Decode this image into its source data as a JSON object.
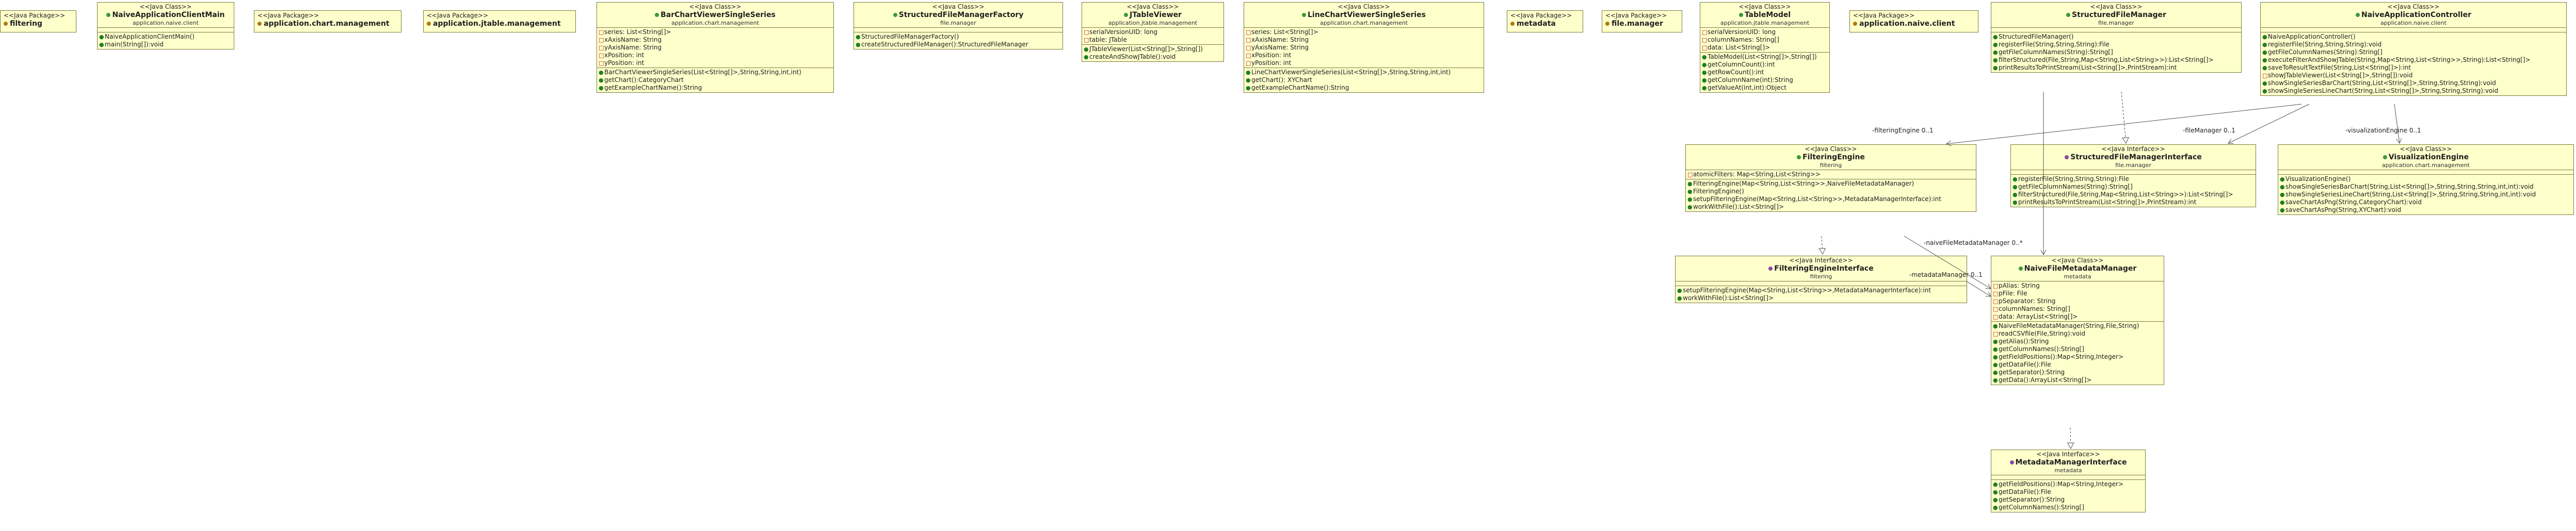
{
  "colors": {
    "box_fill": "#ffffcc",
    "box_border": "#7a7a3a",
    "class_icon": "#3a9a3a",
    "interface_icon": "#8a4aa0",
    "package_icon": "#b07a10",
    "private": "#c01010",
    "protected": "#c09010",
    "public": "#208020"
  },
  "packages": [
    {
      "id": "pkg-filtering",
      "stereotype": "<<Java Package>>",
      "name": "filtering"
    },
    {
      "id": "pkg-chart",
      "stereotype": "<<Java Package>>",
      "name": "application.chart.management"
    },
    {
      "id": "pkg-jtable",
      "stereotype": "<<Java Package>>",
      "name": "application.jtable.management"
    },
    {
      "id": "pkg-metadata",
      "stereotype": "<<Java Package>>",
      "name": "metadata"
    },
    {
      "id": "pkg-filemanager",
      "stereotype": "<<Java Package>>",
      "name": "file.manager"
    },
    {
      "id": "pkg-naive",
      "stereotype": "<<Java Package>>",
      "name": "application.naive.client"
    }
  ],
  "classes": [
    {
      "id": "c-naivemain",
      "stereotype": "<<Java Class>>",
      "name": "NaiveApplicationClientMain",
      "package": "application.naive.client",
      "kind": "class",
      "attributes": [],
      "operations": [
        {
          "vis": "public",
          "text": "NaiveApplicationClientMain()"
        },
        {
          "vis": "public",
          "text": "main(String[]):void"
        }
      ]
    },
    {
      "id": "c-barchart",
      "stereotype": "<<Java Class>>",
      "name": "BarChartViewerSingleSeries",
      "package": "application.chart.management",
      "kind": "class",
      "attributes": [
        {
          "vis": "private",
          "text": "series: List<String[]>"
        },
        {
          "vis": "private",
          "text": "xAxisName: String"
        },
        {
          "vis": "private",
          "text": "yAxisName: String"
        },
        {
          "vis": "private",
          "text": "xPosition: int"
        },
        {
          "vis": "private",
          "text": "yPosition: int"
        }
      ],
      "operations": [
        {
          "vis": "public",
          "text": "BarChartViewerSingleSeries(List<String[]>,String,String,int,int)"
        },
        {
          "vis": "public",
          "text": "getChart():CategoryChart"
        },
        {
          "vis": "public",
          "text": "getExampleChartName():String"
        }
      ]
    },
    {
      "id": "c-sfmfactory",
      "stereotype": "<<Java Class>>",
      "name": "StructuredFileManagerFactory",
      "package": "file.manager",
      "kind": "class",
      "attributes": [],
      "operations": [
        {
          "vis": "public",
          "text": "StructuredFileManagerFactory()"
        },
        {
          "vis": "public",
          "text": "createStructuredFileManager():StructuredFileManager"
        }
      ]
    },
    {
      "id": "c-jtableviewer",
      "stereotype": "<<Java Class>>",
      "name": "JTableViewer",
      "package": "application.jtable.management",
      "kind": "class",
      "attributes": [
        {
          "vis": "private",
          "text": "serialVersionUID: long"
        },
        {
          "vis": "private",
          "text": "table: JTable"
        }
      ],
      "operations": [
        {
          "vis": "public",
          "text": "JTableViewer(List<String[]>,String[])"
        },
        {
          "vis": "public",
          "text": "createAndShowJTable():void"
        }
      ]
    },
    {
      "id": "c-linechart",
      "stereotype": "<<Java Class>>",
      "name": "LineChartViewerSingleSeries",
      "package": "application.chart.management",
      "kind": "class",
      "attributes": [
        {
          "vis": "private",
          "text": "series: List<String[]>"
        },
        {
          "vis": "private",
          "text": "xAxisName: String"
        },
        {
          "vis": "private",
          "text": "yAxisName: String"
        },
        {
          "vis": "private",
          "text": "xPosition: int"
        },
        {
          "vis": "private",
          "text": "yPosition: int"
        }
      ],
      "operations": [
        {
          "vis": "public",
          "text": "LineChartViewerSingleSeries(List<String[]>,String,String,int,int)"
        },
        {
          "vis": "public",
          "text": "getChart(): XYChart"
        },
        {
          "vis": "public",
          "text": "getExampleChartName():String"
        }
      ]
    },
    {
      "id": "c-tablemodel",
      "stereotype": "<<Java Class>>",
      "name": "TableModel",
      "package": "application.jtable.management",
      "kind": "class",
      "attributes": [
        {
          "vis": "private",
          "text": "serialVersionUID: long"
        },
        {
          "vis": "private",
          "text": "columnNames: String[]"
        },
        {
          "vis": "private",
          "text": "data: List<String[]>"
        }
      ],
      "operations": [
        {
          "vis": "public",
          "text": "TableModel(List<String[]>,String[])"
        },
        {
          "vis": "public",
          "text": "getColumnCount():int"
        },
        {
          "vis": "public",
          "text": "getRowCount():int"
        },
        {
          "vis": "public",
          "text": "getColumnName(int):String"
        },
        {
          "vis": "public",
          "text": "getValueAt(int,int):Object"
        }
      ]
    },
    {
      "id": "c-sfm",
      "stereotype": "<<Java Class>>",
      "name": "StructuredFileManager",
      "package": "file.manager",
      "kind": "class",
      "attributes": [],
      "operations": [
        {
          "vis": "public",
          "text": "StructuredFileManager()"
        },
        {
          "vis": "public",
          "text": "registerFile(String,String,String):File"
        },
        {
          "vis": "public",
          "text": "getFileColumnNames(String):String[]"
        },
        {
          "vis": "public",
          "text": "filterStructured(File,String,Map<String,List<String>>):List<String[]>"
        },
        {
          "vis": "public",
          "text": "printResultsToPrintStream(List<String[]>,PrintStream):int"
        }
      ]
    },
    {
      "id": "c-nac",
      "stereotype": "<<Java Class>>",
      "name": "NaiveApplicationController",
      "package": "application.naive.client",
      "kind": "class",
      "attributes": [],
      "operations": [
        {
          "vis": "public",
          "text": "NaiveApplicationController()"
        },
        {
          "vis": "public",
          "text": "registerFile(String,String,String):void"
        },
        {
          "vis": "public",
          "text": "getFileColumnNames(String):String[]"
        },
        {
          "vis": "public",
          "text": "executeFilterAndShowJTable(String,Map<String,List<String>>,String):List<String[]>"
        },
        {
          "vis": "public",
          "text": "saveToResultTextFile(String,List<String[]>):int"
        },
        {
          "vis": "private",
          "text": "showJTableViewer(List<String[]>,String[]):void"
        },
        {
          "vis": "public",
          "text": "showSingleSeriesBarChart(String,List<String[]>,String,String,String):void"
        },
        {
          "vis": "public",
          "text": "showSingleSeriesLineChart(String,List<String[]>,String,String,String):void"
        }
      ]
    },
    {
      "id": "c-filteringengine",
      "stereotype": "<<Java Class>>",
      "name": "FilteringEngine",
      "package": "filtering",
      "kind": "class",
      "attributes": [
        {
          "vis": "private",
          "text": "atomicFilters: Map<String,List<String>>"
        }
      ],
      "operations": [
        {
          "vis": "public",
          "text": "FilteringEngine(Map<String,List<String>>,NaiveFileMetadataManager)"
        },
        {
          "vis": "public",
          "text": "FilteringEngine()"
        },
        {
          "vis": "public",
          "text": "setupFilteringEngine(Map<String,List<String>>,MetadataManagerInterface):int"
        },
        {
          "vis": "public",
          "text": "workWithFile():List<String[]>"
        }
      ]
    },
    {
      "id": "c-sfmi",
      "stereotype": "<<Java Interface>>",
      "name": "StructuredFileManagerInterface",
      "package": "file.manager",
      "kind": "interface",
      "attributes": [],
      "operations": [
        {
          "vis": "public",
          "text": "registerFile(String,String,String):File"
        },
        {
          "vis": "public",
          "text": "getFileColumnNames(String):String[]"
        },
        {
          "vis": "public",
          "text": "filterStructured(File,String,Map<String,List<String>>):List<String[]>"
        },
        {
          "vis": "public",
          "text": "printResultsToPrintStream(List<String[]>,PrintStream):int"
        }
      ]
    },
    {
      "id": "c-vizengine",
      "stereotype": "<<Java Class>>",
      "name": "VisualizationEngine",
      "package": "application.chart.management",
      "kind": "class",
      "attributes": [],
      "operations": [
        {
          "vis": "public",
          "text": "VisualizationEngine()"
        },
        {
          "vis": "public",
          "text": "showSingleSeriesBarChart(String,List<String[]>,String,String,String,int,int):void"
        },
        {
          "vis": "public",
          "text": "showSingleSeriesLineChart(String,List<String[]>,String,String,String,int,int):void"
        },
        {
          "vis": "public",
          "text": "saveChartAsPng(String,CategoryChart):void"
        },
        {
          "vis": "public",
          "text": "saveChartAsPng(String,XYChart):void"
        }
      ]
    },
    {
      "id": "c-fei",
      "stereotype": "<<Java Interface>>",
      "name": "FilteringEngineInterface",
      "package": "filtering",
      "kind": "interface",
      "attributes": [],
      "operations": [
        {
          "vis": "public",
          "text": "setupFilteringEngine(Map<String,List<String>>,MetadataManagerInterface):int"
        },
        {
          "vis": "public",
          "text": "workWithFile():List<String[]>"
        }
      ]
    },
    {
      "id": "c-nfmm",
      "stereotype": "<<Java Class>>",
      "name": "NaiveFileMetadataManager",
      "package": "metadata",
      "kind": "class",
      "attributes": [
        {
          "vis": "private",
          "text": "pAlias: String"
        },
        {
          "vis": "private",
          "text": "pFile: File"
        },
        {
          "vis": "private",
          "text": "pSeparator: String"
        },
        {
          "vis": "private",
          "text": "columnNames: String[]"
        },
        {
          "vis": "private",
          "text": "data: ArrayList<String[]>"
        }
      ],
      "operations": [
        {
          "vis": "public",
          "text": "NaiveFileMetadataManager(String,File,String)"
        },
        {
          "vis": "private",
          "text": "readCSVfile(File,String):void"
        },
        {
          "vis": "public",
          "text": "getAlias():String"
        },
        {
          "vis": "public",
          "text": "getColumnNames():String[]"
        },
        {
          "vis": "public",
          "text": "getFieldPositions():Map<String,Integer>"
        },
        {
          "vis": "public",
          "text": "getDataFile():File"
        },
        {
          "vis": "public",
          "text": "getSeparator():String"
        },
        {
          "vis": "public",
          "text": "getData():ArrayList<String[]>"
        }
      ]
    },
    {
      "id": "c-mmi",
      "stereotype": "<<Java Interface>>",
      "name": "MetadataManagerInterface",
      "package": "metadata",
      "kind": "interface",
      "attributes": [],
      "operations": [
        {
          "vis": "public",
          "text": "getFieldPositions():Map<String,Integer>"
        },
        {
          "vis": "public",
          "text": "getDataFile():File"
        },
        {
          "vis": "public",
          "text": "getSeparator():String"
        },
        {
          "vis": "public",
          "text": "getColumnNames():String[]"
        }
      ]
    }
  ],
  "edge_labels": {
    "filteringEngine": "-filteringEngine",
    "filteringEngine_mult": "0..1",
    "fileManager": "-fileManager",
    "fileManager_mult": "0..1",
    "visualizationEngine": "-visualizationEngine",
    "visualizationEngine_mult": "0..1",
    "naiveFileMetadataManager": "-naiveFileMetadataManager",
    "naiveFileMetadataManager_mult": "0..*",
    "metadataManager": "-metadataManager",
    "metadataManager_mult": "0..1"
  }
}
